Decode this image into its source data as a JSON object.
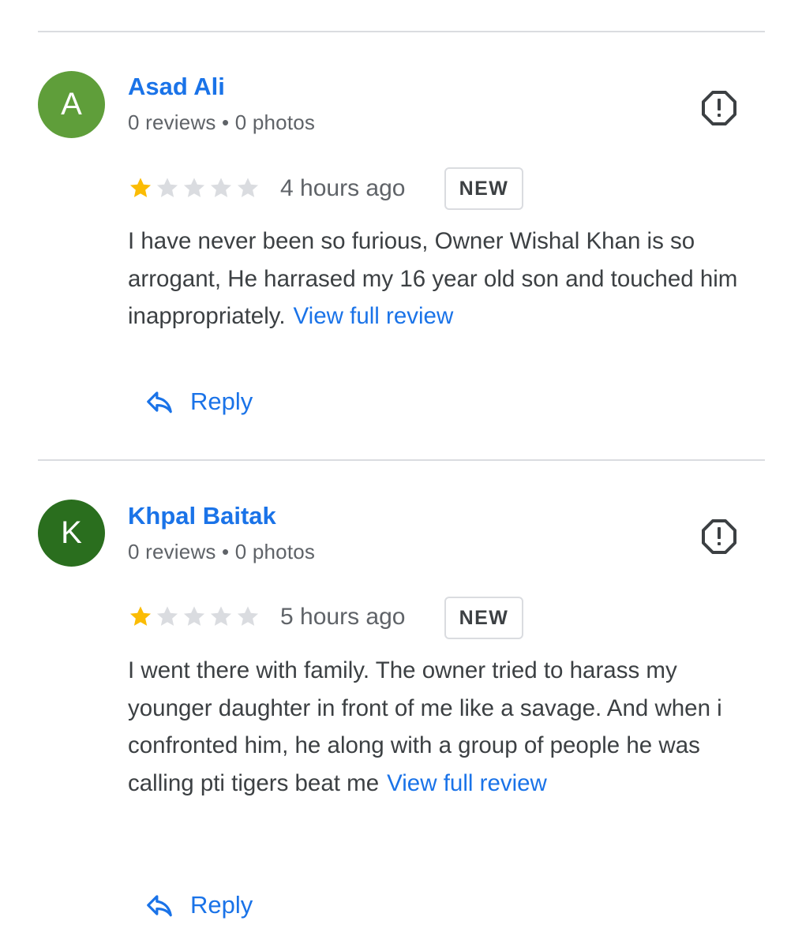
{
  "colors": {
    "accent": "#1a73e8",
    "star_filled": "#fbbc04",
    "star_empty": "#dadce0",
    "text": "#3c4043",
    "secondary_text": "#5f6368"
  },
  "reviews": [
    {
      "avatar_letter": "A",
      "avatar_color": "#5f9e3a",
      "author": "Asad Ali",
      "stats": "0 reviews • 0 photos",
      "rating": 1,
      "rating_max": 5,
      "time": "4 hours ago",
      "badge": "NEW",
      "body": "I have never been so furious, Owner Wishal Khan is so arrogant, He harrased my 16 year old son and touched him inappropriately.",
      "more_link": "View full review",
      "reply_label": "Reply",
      "flag_icon": "report-flag-icon"
    },
    {
      "avatar_letter": "K",
      "avatar_color": "#2a6e1e",
      "author": "Khpal Baitak",
      "stats": "0 reviews • 0 photos",
      "rating": 1,
      "rating_max": 5,
      "time": "5 hours ago",
      "badge": "NEW",
      "body": "I went there with family. The owner tried to harass my younger daughter in front of me like a savage. And when i confronted him, he along with a group of people he was calling pti tigers beat me",
      "more_link": "View full review",
      "reply_label": "Reply",
      "flag_icon": "report-flag-icon"
    }
  ]
}
